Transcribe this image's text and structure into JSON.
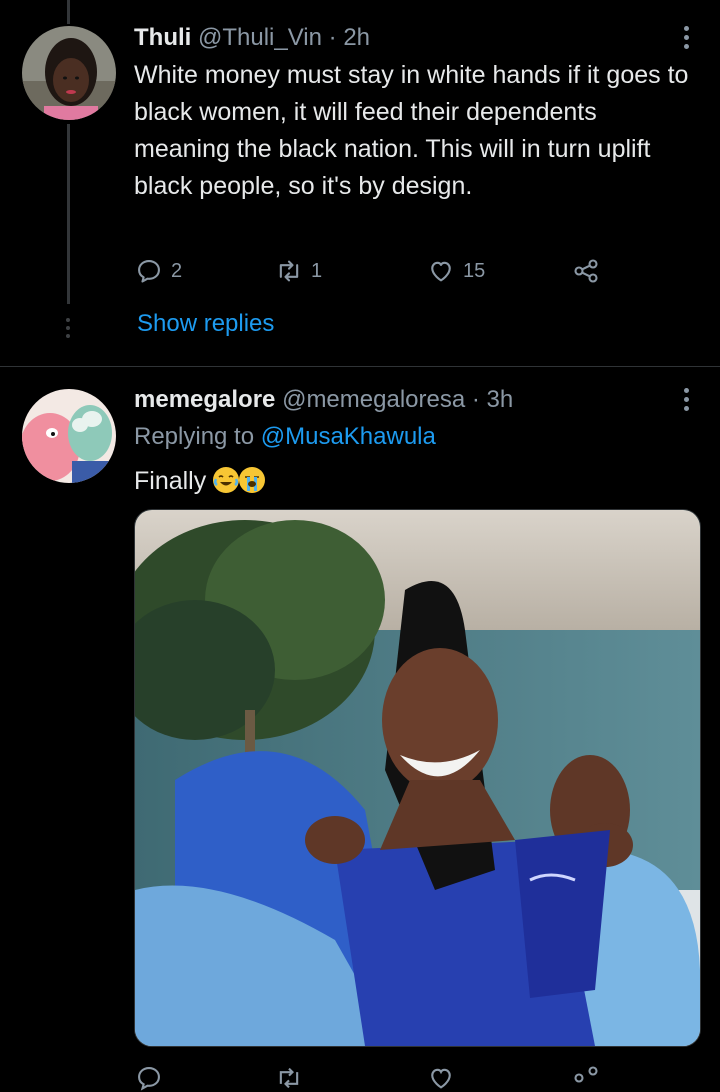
{
  "tweet1": {
    "display_name": "Thuli",
    "handle": "@Thuli_Vin",
    "sep": "·",
    "time": "2h",
    "text": "White money must stay in white hands if it goes to black women, it will feed their dependents meaning the black nation. This will in turn uplift black people, so it's by design.",
    "replies": "2",
    "retweets": "1",
    "likes": "15",
    "show_replies": "Show replies"
  },
  "tweet2": {
    "display_name": "memegalore",
    "handle": "@memegaloresa",
    "sep": "·",
    "time": "3h",
    "replying_prefix": "Replying to",
    "replying_handle": "@MusaKhawula",
    "text": "Finally",
    "emojis": [
      "face-with-tears-of-joy",
      "loudly-crying-face"
    ]
  },
  "colors": {
    "accent": "#1d9bf0",
    "muted": "#8b98a5",
    "background": "#000000",
    "text": "#e7e9ea"
  },
  "icons": [
    "reply-icon",
    "retweet-icon",
    "like-icon",
    "share-icon",
    "more-icon"
  ]
}
